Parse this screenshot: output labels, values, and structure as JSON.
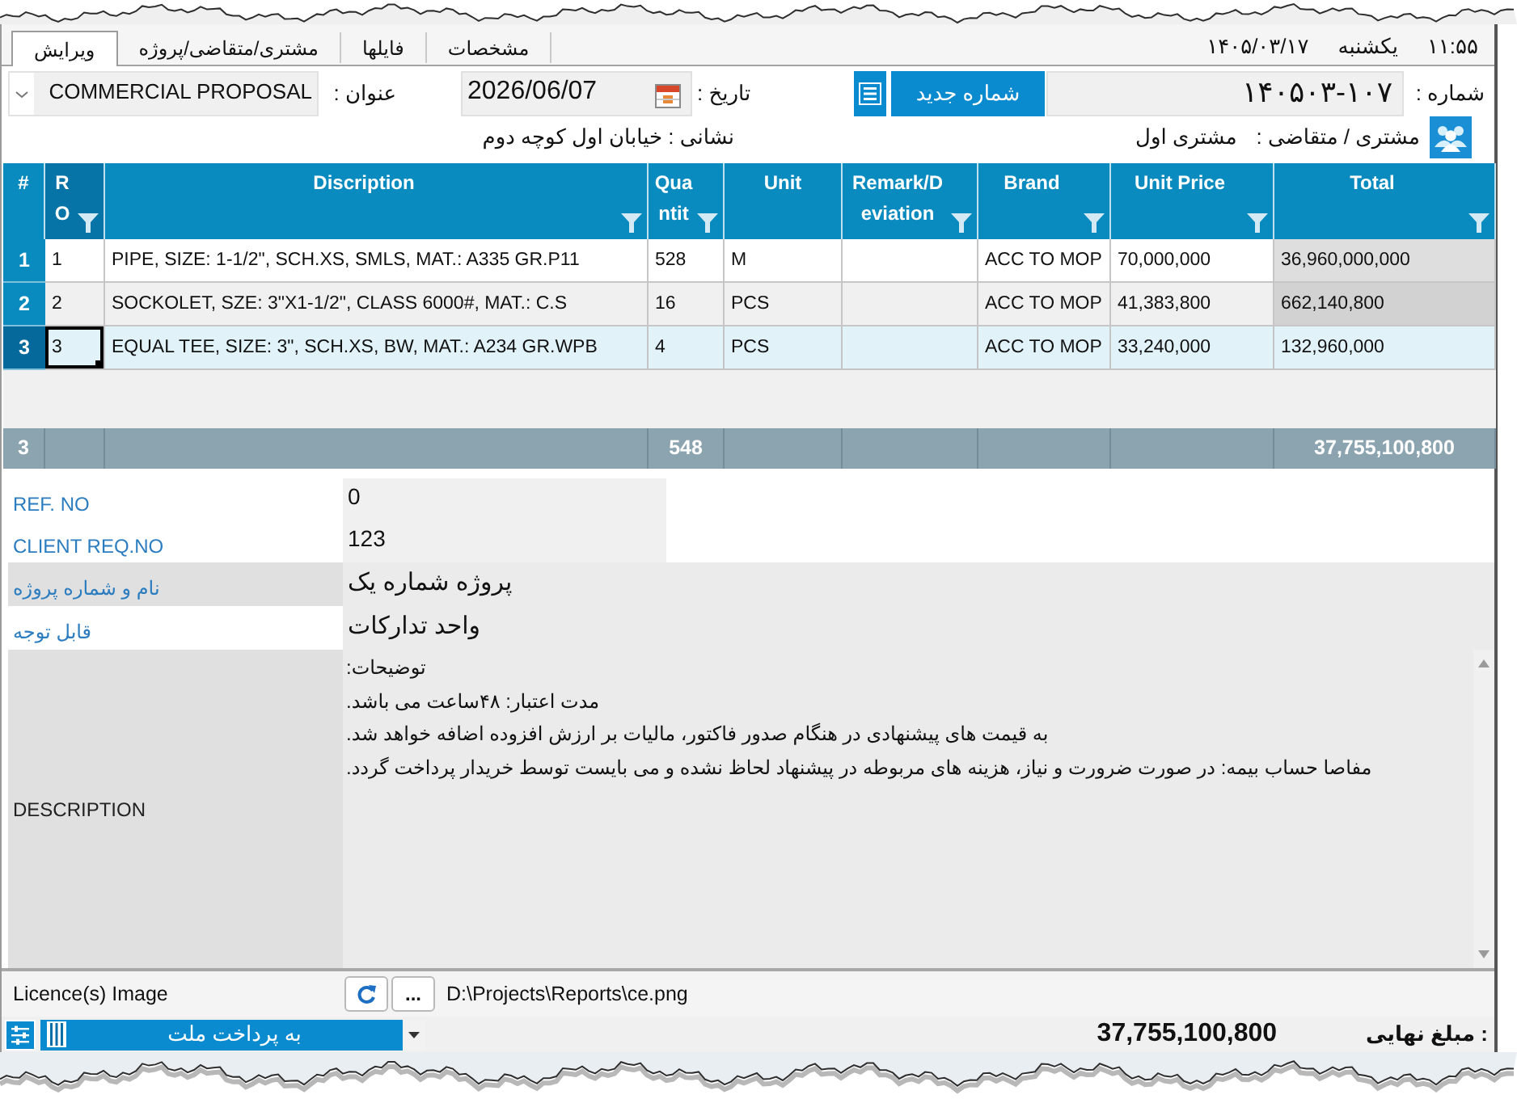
{
  "header": {
    "time": "۱۱:۵۵",
    "weekday": "یکشنبه",
    "date": "۱۴۰۵/۰۳/۱۷"
  },
  "tabs": [
    {
      "label": "مشخصات",
      "selected": false
    },
    {
      "label": "فایلها",
      "selected": false
    },
    {
      "label": "مشتری/متقاضی/پروژه",
      "selected": false
    },
    {
      "label": "ویرایش",
      "selected": true
    }
  ],
  "form": {
    "title": {
      "label": "عنوان :",
      "value": "COMMERCIAL PROPOSAL"
    },
    "date": {
      "label": "تاریخ :",
      "value": "2026/06/07"
    },
    "number": {
      "label": "شماره :",
      "value": "۱۴۰۵۰۳-۱۰۷",
      "new_button": "شماره جدید"
    },
    "address": "نشانی : خیابان اول کوچه دوم",
    "customer": {
      "label": "مشتری / متقاضی :",
      "value": "مشتری اول"
    }
  },
  "table": {
    "columns": [
      {
        "label": "Total",
        "filter": true,
        "selected": false,
        "readonly": true
      },
      {
        "label": "Unit Price",
        "filter": true,
        "selected": false,
        "readonly": false
      },
      {
        "label": "Brand",
        "filter": true,
        "selected": false,
        "readonly": false
      },
      {
        "label": "Remark/Deviation",
        "filter": true,
        "selected": false,
        "readonly": false
      },
      {
        "label": "Unit",
        "filter": false,
        "selected": false,
        "readonly": false
      },
      {
        "label": "Quantit",
        "filter": true,
        "selected": false,
        "readonly": false
      },
      {
        "label": "Discription",
        "filter": true,
        "selected": false,
        "readonly": false
      },
      {
        "label": "RO",
        "filter": true,
        "selected": true,
        "readonly": false
      }
    ],
    "row_header": {
      "label": "#"
    },
    "rows": [
      {
        "cells": [
          {
            "text": "36,960,000,000",
            "focused": false
          },
          {
            "text": "70,000,000",
            "focused": false
          },
          {
            "text": "ACC TO MOP",
            "focused": false
          },
          {
            "focused": false
          },
          {
            "text": "M",
            "focused": false
          },
          {
            "text": "528",
            "focused": false
          },
          {
            "text": "PIPE, SIZE: 1-1/2\", SCH.XS, SMLS, MAT.: A335 GR.P11",
            "focused": false
          },
          {
            "text": "1",
            "focused": false
          }
        ],
        "number": "1",
        "selected": false
      },
      {
        "cells": [
          {
            "text": "662,140,800",
            "focused": false
          },
          {
            "text": "41,383,800",
            "focused": false
          },
          {
            "text": "ACC TO MOP",
            "focused": false
          },
          {
            "focused": false
          },
          {
            "text": "PCS",
            "focused": false
          },
          {
            "text": "16",
            "focused": false
          },
          {
            "text": "SOCKOLET, SZE: 3\"X1-1/2\", CLASS 6000#, MAT.: C.S",
            "focused": false
          },
          {
            "text": "2",
            "focused": false
          }
        ],
        "number": "2",
        "selected": false
      },
      {
        "cells": [
          {
            "text": "132,960,000",
            "focused": false
          },
          {
            "text": "33,240,000",
            "focused": false
          },
          {
            "text": "ACC TO MOP",
            "focused": false
          },
          {
            "focused": false
          },
          {
            "text": "PCS",
            "focused": false
          },
          {
            "text": "4",
            "focused": false
          },
          {
            "text": "EQUAL TEE, SIZE: 3\", SCH.XS, BW, MAT.: A234 GR.WPB",
            "focused": false
          },
          {
            "text": "3",
            "focused": true
          }
        ],
        "number": "3",
        "selected": true
      }
    ],
    "totals": {
      "amount": "37,755,100,800",
      "quantity": "548",
      "count": "3"
    }
  },
  "fields": [
    {
      "label": "REF. NO",
      "value": "0",
      "kind": "short",
      "shaded": false
    },
    {
      "label": "CLIENT REQ.NO",
      "value": "123",
      "kind": "short",
      "shaded": false
    },
    {
      "label": "نام و شماره پروژه",
      "value": "پروژه شماره یک",
      "kind": "wide",
      "shaded": true
    },
    {
      "label": "قابل توجه",
      "value": "واحد تدارکات",
      "kind": "wide",
      "shaded": false
    }
  ],
  "description": {
    "label": "DESCRIPTION",
    "lines": [
      "توضیحات:",
      "مدت اعتبار:  ۴۸ساعت می باشد.",
      "به قیمت های پیشنهادی در هنگام صدور فاکتور، مالیات بر ارزش افزوده اضافه خواهد شد.",
      "مفاصا حساب بیمه: در صورت ضرورت و نیاز، هزینه های مربوطه در پیشنهاد لحاظ نشده و می بایست توسط خریدار پرداخت گردد."
    ]
  },
  "licence": {
    "label": "Licence(s) Image",
    "browse_button": "...",
    "path": "D:\\Projects\\Reports\\ce.png"
  },
  "footer_bar": {
    "payment": "به پرداخت ملت",
    "total_label": ": مبلغ نهایی",
    "total_value": "37,755,100,800"
  }
}
